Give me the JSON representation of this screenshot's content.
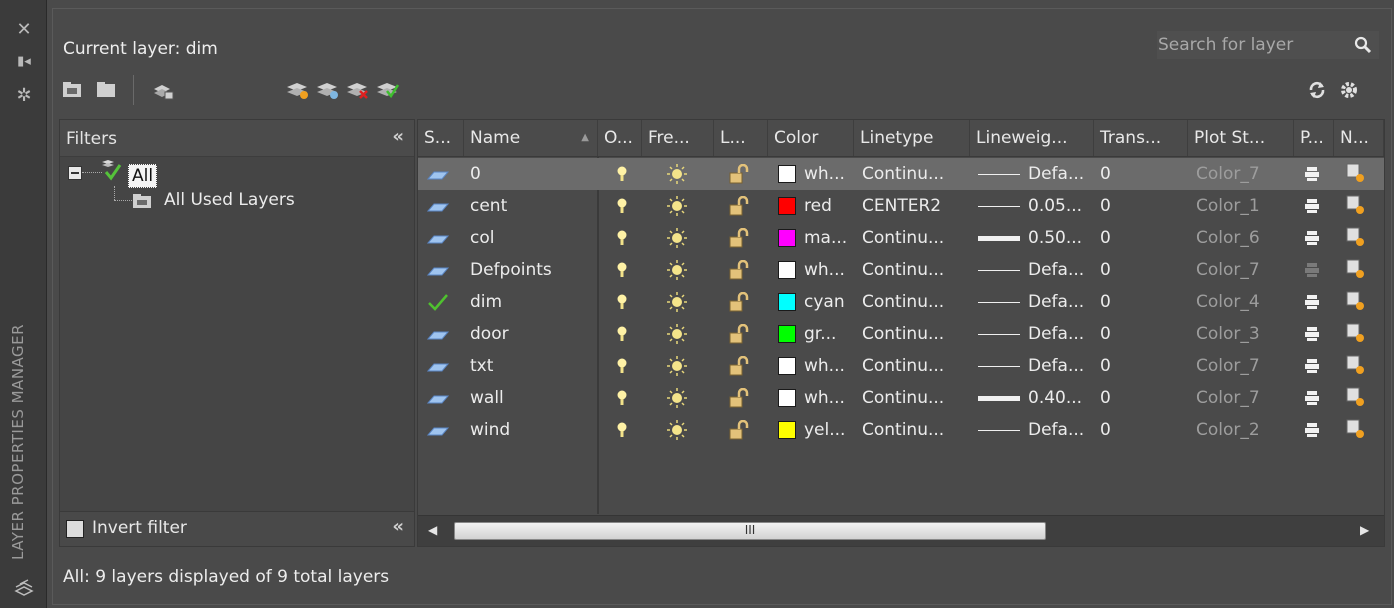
{
  "palette": {
    "vertical_title": "LAYER PROPERTIES MANAGER"
  },
  "header": {
    "current_layer": "Current layer: dim",
    "search_placeholder": "Search for layer"
  },
  "filters": {
    "title": "Filters",
    "tree": [
      {
        "label": "All",
        "selected": true
      },
      {
        "label": "All Used Layers",
        "selected": false
      }
    ],
    "invert_filter_label": "Invert filter",
    "invert_filter_checked": false
  },
  "grid": {
    "columns": [
      "S...",
      "Name",
      "O...",
      "Fre...",
      "L...",
      "Color",
      "Linetype",
      "Lineweig...",
      "Trans...",
      "Plot St...",
      "P...",
      "N..."
    ],
    "rows": [
      {
        "status": "layer",
        "name": "0",
        "color_name": "wh...",
        "color": "#ffffff",
        "linetype": "Continu...",
        "lineweight": "Defa...",
        "lw_thick": false,
        "transparency": "0",
        "plot_style": "Color_7",
        "plot": true,
        "selected": true
      },
      {
        "status": "layer",
        "name": "cent",
        "color_name": "red",
        "color": "#ff0000",
        "linetype": "CENTER2",
        "lineweight": "0.05...",
        "lw_thick": false,
        "transparency": "0",
        "plot_style": "Color_1",
        "plot": true,
        "selected": false
      },
      {
        "status": "layer",
        "name": "col",
        "color_name": "ma...",
        "color": "#ff00ff",
        "linetype": "Continu...",
        "lineweight": "0.50...",
        "lw_thick": true,
        "transparency": "0",
        "plot_style": "Color_6",
        "plot": true,
        "selected": false
      },
      {
        "status": "layer",
        "name": "Defpoints",
        "color_name": "wh...",
        "color": "#ffffff",
        "linetype": "Continu...",
        "lineweight": "Defa...",
        "lw_thick": false,
        "transparency": "0",
        "plot_style": "Color_7",
        "plot": false,
        "selected": false
      },
      {
        "status": "current",
        "name": "dim",
        "color_name": "cyan",
        "color": "#00ffff",
        "linetype": "Continu...",
        "lineweight": "Defa...",
        "lw_thick": false,
        "transparency": "0",
        "plot_style": "Color_4",
        "plot": true,
        "selected": false
      },
      {
        "status": "layer",
        "name": "door",
        "color_name": "gr...",
        "color": "#00ff00",
        "linetype": "Continu...",
        "lineweight": "Defa...",
        "lw_thick": false,
        "transparency": "0",
        "plot_style": "Color_3",
        "plot": true,
        "selected": false
      },
      {
        "status": "layer",
        "name": "txt",
        "color_name": "wh...",
        "color": "#ffffff",
        "linetype": "Continu...",
        "lineweight": "Defa...",
        "lw_thick": false,
        "transparency": "0",
        "plot_style": "Color_7",
        "plot": true,
        "selected": false
      },
      {
        "status": "layer",
        "name": "wall",
        "color_name": "wh...",
        "color": "#ffffff",
        "linetype": "Continu...",
        "lineweight": "0.40...",
        "lw_thick": true,
        "transparency": "0",
        "plot_style": "Color_7",
        "plot": true,
        "selected": false
      },
      {
        "status": "layer",
        "name": "wind",
        "color_name": "yel...",
        "color": "#ffff00",
        "linetype": "Continu...",
        "lineweight": "Defa...",
        "lw_thick": false,
        "transparency": "0",
        "plot_style": "Color_2",
        "plot": true,
        "selected": false
      }
    ]
  },
  "scrollbar": {
    "grip": "III"
  },
  "status_bar": "All: 9 layers displayed of 9 total layers"
}
